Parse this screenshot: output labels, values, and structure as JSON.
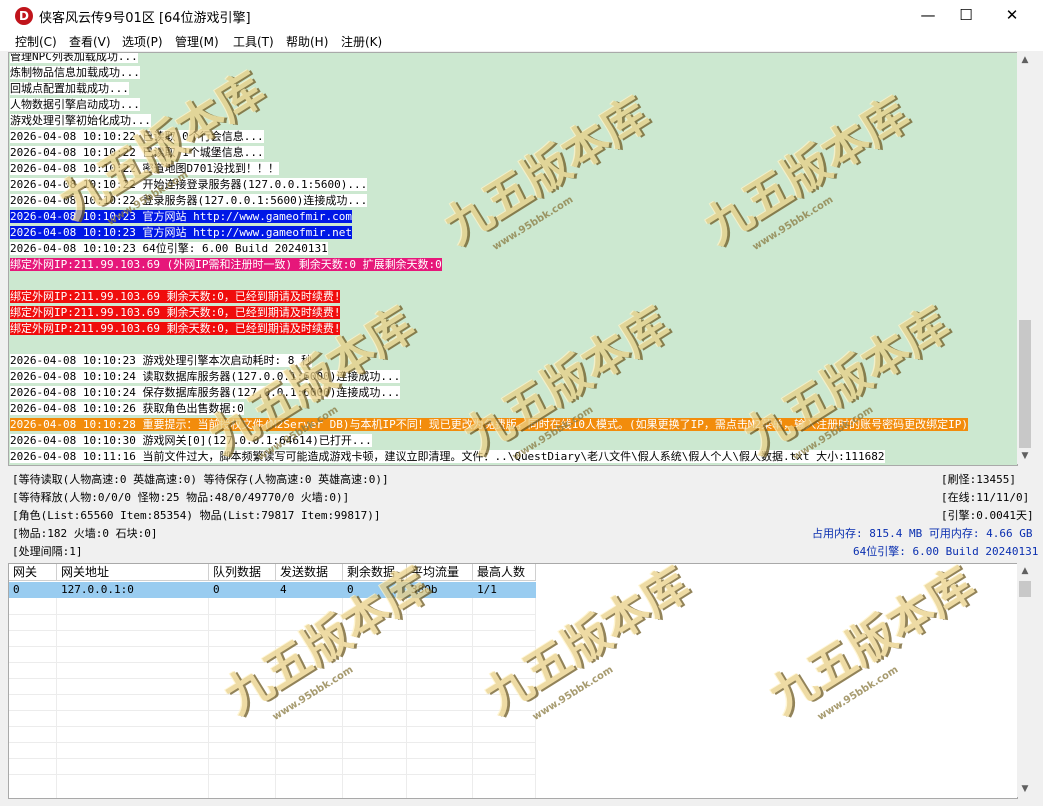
{
  "window": {
    "title": "侠客风云传9号01区 [64位游戏引擎]",
    "icon_letter": "D",
    "controls": {
      "minimize": "—",
      "maximize": "☐",
      "close": "✕"
    }
  },
  "menu": [
    "控制(C)",
    "查看(V)",
    "选项(P)",
    "管理(M)",
    "工具(T)",
    "帮助(H)",
    "注册(K)"
  ],
  "log": {
    "lines": [
      {
        "text": "管理NPC列表加载成功...",
        "style": "white"
      },
      {
        "text": "炼制物品信息加载成功...",
        "style": "white"
      },
      {
        "text": "回城点配置加载成功...",
        "style": "white"
      },
      {
        "text": "人物数据引擎启动成功...",
        "style": "white"
      },
      {
        "text": "游戏处理引擎初始化成功...",
        "style": "white"
      },
      {
        "text": "2026-04-08 10:10:22 已读取 0个行会信息...",
        "style": "white"
      },
      {
        "text": "2026-04-08 10:10:22 已读取 1个城堡信息...",
        "style": "white"
      },
      {
        "text": "2026-04-08 10:10:22 密道地图D701没找到！！！",
        "style": "white"
      },
      {
        "text": "2026-04-08 10:10:22 开始连接登录服务器(127.0.0.1:5600)...",
        "style": "white"
      },
      {
        "text": "2026-04-08 10:10:22 登录服务器(127.0.0.1:5600)连接成功...",
        "style": "white"
      },
      {
        "text": "2026-04-08 10:10:23 官方网站 http://www.gameofmir.com",
        "style": "blue"
      },
      {
        "text": "2026-04-08 10:10:23 官方网站 http://www.gameofmir.net",
        "style": "blue"
      },
      {
        "text": "2026-04-08 10:10:23 64位引擎: 6.00 Build 20240131",
        "style": "white"
      },
      {
        "text": "绑定外网IP:211.99.103.69 (外网IP需和注册时一致) 剩余天数:0 扩展剩余天数:0",
        "style": "pink"
      },
      {
        "text": "",
        "style": "none"
      },
      {
        "text": "绑定外网IP:211.99.103.69 剩余天数:0，已经到期请及时续费!",
        "style": "red"
      },
      {
        "text": "绑定外网IP:211.99.103.69 剩余天数:0，已经到期请及时续费!",
        "style": "red"
      },
      {
        "text": "绑定外网IP:211.99.103.69 剩余天数:0，已经到期请及时续费!",
        "style": "red"
      },
      {
        "text": "",
        "style": "none"
      },
      {
        "text": "2026-04-08 10:10:23 游戏处理引擎本次启动耗时: 8 秒",
        "style": "white"
      },
      {
        "text": "2026-04-08 10:10:24 读取数据库服务器(127.0.0.1:6000)连接成功...",
        "style": "white"
      },
      {
        "text": "2026-04-08 10:10:24 保存数据库服务器(127.0.0.1:6000)连接成功...",
        "style": "white"
      },
      {
        "text": "2026-04-08 10:10:26 获取角色出售数据:0",
        "style": "white"
      },
      {
        "text": "2026-04-08 10:10:28 重要提示：当前授权文件(M2Server DB)与本机IP不同！现已更改为免费版，同时在线10人模式。(如果更换了IP，需点击M2菜单，输入注册时的账号密码更改绑定IP)",
        "style": "orange"
      },
      {
        "text": "2026-04-08 10:10:30 游戏网关[0](127.0.0.1:64614)已打开...",
        "style": "white"
      },
      {
        "text": "2026-04-08 10:11:16 当前文件过大，脚本频繁读写可能造成游戏卡顿，建议立即清理。文件：..\\QuestDiary\\老八文件\\假人系统\\假人个人\\假人数据.txt 大小:111682",
        "style": "white"
      }
    ]
  },
  "status": {
    "left": [
      "[等待读取(人物高速:0 英雄高速:0) 等待保存(人物高速:0 英雄高速:0)]",
      "[等待释放(人物:0/0/0 怪物:25 物品:48/0/49770/0 火墙:0)]",
      "[角色(List:65560 Item:85354) 物品(List:79817 Item:99817)]",
      "[物品:182 火墙:0 石块:0]",
      "[处理间隔:1]"
    ],
    "right": {
      "refresh": "[刷怪:13455]",
      "online": "[在线:11/11/0]",
      "engine": "[引擎:0.0041天]",
      "memory": "占用内存: 815.4 MB 可用内存: 4.66 GB",
      "version": "64位引擎: 6.00 Build 20240131"
    }
  },
  "gateway_table": {
    "columns": [
      "网关",
      "网关地址",
      "队列数据",
      "发送数据",
      "剩余数据",
      "平均流量",
      "最高人数"
    ],
    "rows": [
      [
        "0",
        "127.0.0.1:0",
        "0",
        "4",
        "0",
        "380b",
        "1/1"
      ]
    ]
  },
  "watermark": {
    "main": "九五版本库",
    "sub": "www.95bbk.com"
  },
  "colors": {
    "log_bg": "#cce8d0",
    "blue_hl": "#0018e6",
    "pink_hl": "#e6177a",
    "red_hl": "#f00c0c",
    "orange_hl": "#f28c0c",
    "row_selected": "#99ccf0"
  },
  "icons": {
    "scroll_up": "▲",
    "scroll_down": "▼"
  }
}
